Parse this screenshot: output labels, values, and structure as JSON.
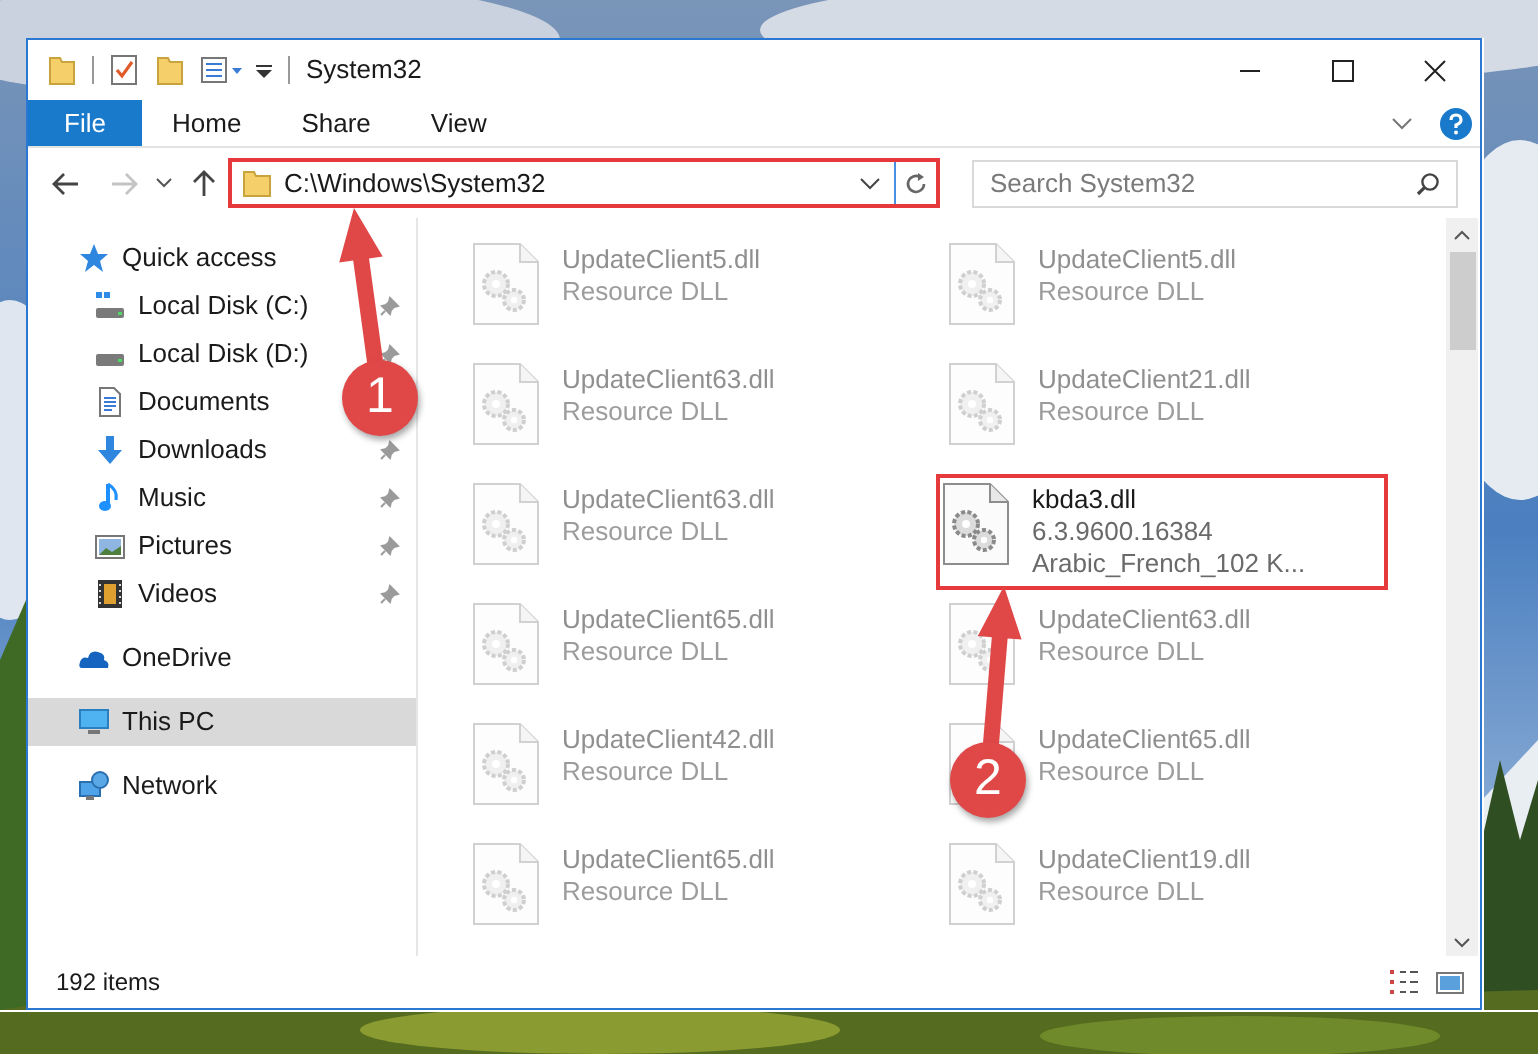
{
  "window": {
    "title": "System32"
  },
  "ribbon_tabs": [
    {
      "label": "File",
      "kind": "file"
    },
    {
      "label": "Home",
      "kind": "tab"
    },
    {
      "label": "Share",
      "kind": "tab"
    },
    {
      "label": "View",
      "kind": "tab"
    }
  ],
  "address_bar": {
    "path": "C:\\Windows\\System32",
    "highlighted": true
  },
  "search": {
    "placeholder": "Search System32"
  },
  "sidebar": {
    "items": [
      {
        "label": "Quick access",
        "kind": "star",
        "selected": false,
        "children": [
          {
            "label": "Local Disk (C:)",
            "kind": "drive_c",
            "pinned": true,
            "selected": false
          },
          {
            "label": "Local Disk (D:)",
            "kind": "drive",
            "pinned": true,
            "selected": false
          },
          {
            "label": "Documents",
            "kind": "document",
            "selected": false
          },
          {
            "label": "Downloads",
            "kind": "download",
            "pinned": true,
            "selected": false
          },
          {
            "label": "Music",
            "kind": "music",
            "pinned": true,
            "selected": false
          },
          {
            "label": "Pictures",
            "kind": "pictures",
            "pinned": true,
            "selected": false
          },
          {
            "label": "Videos",
            "kind": "videos",
            "pinned": true,
            "selected": false
          }
        ]
      },
      {
        "label": "OneDrive",
        "kind": "cloud",
        "selected": false
      },
      {
        "label": "This PC",
        "kind": "pc",
        "selected": true
      },
      {
        "label": "Network",
        "kind": "network",
        "selected": false
      }
    ]
  },
  "files": [
    {
      "name": "UpdateClient5.dll",
      "details": [
        "Resource DLL"
      ],
      "dimmed": true,
      "highlighted": false
    },
    {
      "name": "UpdateClient5.dll",
      "details": [
        "Resource DLL"
      ],
      "dimmed": true,
      "highlighted": false
    },
    {
      "name": "UpdateClient63.dll",
      "details": [
        "Resource DLL"
      ],
      "dimmed": true,
      "highlighted": false
    },
    {
      "name": "UpdateClient21.dll",
      "details": [
        "Resource DLL"
      ],
      "dimmed": true,
      "highlighted": false
    },
    {
      "name": "UpdateClient63.dll",
      "details": [
        "Resource DLL"
      ],
      "dimmed": true,
      "highlighted": false
    },
    {
      "name": "kbda3.dll",
      "details": [
        "6.3.9600.16384",
        "Arabic_French_102 K..."
      ],
      "dimmed": false,
      "highlighted": true
    },
    {
      "name": "UpdateClient65.dll",
      "details": [
        "Resource DLL"
      ],
      "dimmed": true,
      "highlighted": false
    },
    {
      "name": "UpdateClient63.dll",
      "details": [
        "Resource DLL"
      ],
      "dimmed": true,
      "highlighted": false
    },
    {
      "name": "UpdateClient42.dll",
      "details": [
        "Resource DLL"
      ],
      "dimmed": true,
      "highlighted": false
    },
    {
      "name": "UpdateClient65.dll",
      "details": [
        "Resource DLL"
      ],
      "dimmed": true,
      "highlighted": false
    },
    {
      "name": "UpdateClient65.dll",
      "details": [
        "Resource DLL"
      ],
      "dimmed": true,
      "highlighted": false
    },
    {
      "name": "UpdateClient19.dll",
      "details": [
        "Resource DLL"
      ],
      "dimmed": true,
      "highlighted": false
    }
  ],
  "status_bar": {
    "item_count": "192 items"
  },
  "annotations": [
    {
      "label": "1"
    },
    {
      "label": "2"
    }
  ]
}
